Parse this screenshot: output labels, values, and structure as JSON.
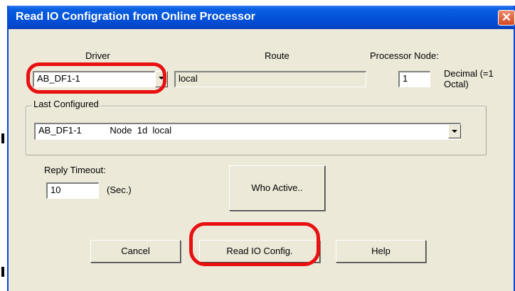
{
  "window": {
    "title": "Read IO Configration from Online Processor"
  },
  "driver": {
    "label": "Driver",
    "value": "AB_DF1-1"
  },
  "route": {
    "label": "Route",
    "value": "local"
  },
  "processor_node": {
    "label": "Processor Node:",
    "value": "1",
    "note": "Decimal (=1 Octal)"
  },
  "last_configured": {
    "label": "Last Configured",
    "value": "AB_DF1-1           Node  1d  local"
  },
  "reply_timeout": {
    "label": "Reply Timeout:",
    "value": "10",
    "unit": "(Sec.)"
  },
  "buttons": {
    "who_active": "Who Active..",
    "cancel": "Cancel",
    "read_io": "Read IO Config.",
    "help": "Help"
  },
  "colors": {
    "highlight": "#e81010",
    "titlebar": "#0453da",
    "dialog_bg": "#ece9d8"
  }
}
